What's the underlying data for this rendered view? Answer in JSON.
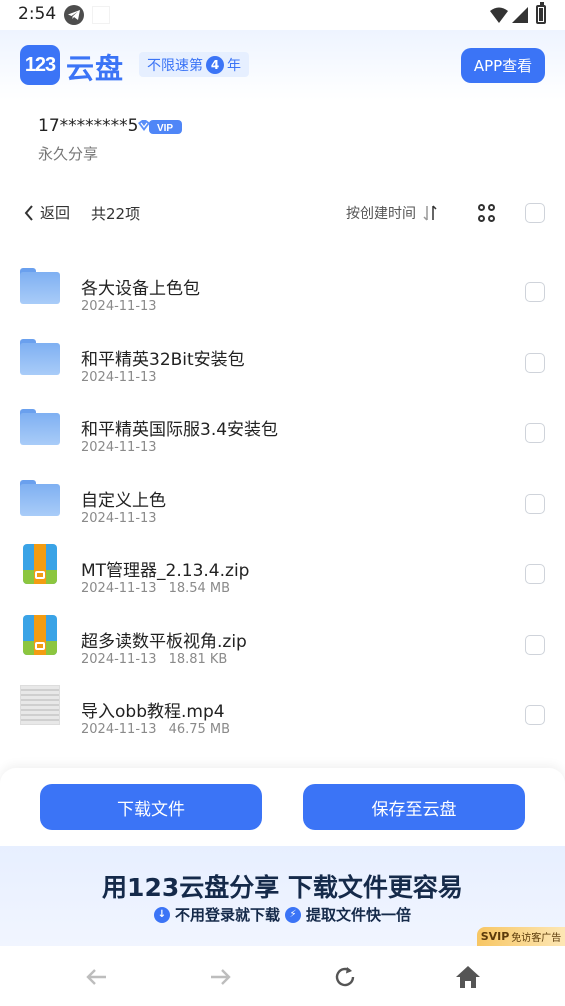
{
  "status_bar": {
    "time": "2:54",
    "icons": [
      "telegram-icon",
      "wifi-icon",
      "signal-icon",
      "battery-icon"
    ]
  },
  "header": {
    "logo_text": "123",
    "brand_name": "云盘",
    "speed_badge_prefix": "不限速第",
    "speed_badge_number": "4",
    "speed_badge_suffix": "年",
    "app_button_label": "APP查看",
    "accent_color": "#3b74f6"
  },
  "share": {
    "user": "17********5",
    "vip_label": "VIP",
    "share_type": "永久分享"
  },
  "toolbar": {
    "back_label": "返回",
    "count_label": "共22项",
    "sort_label": "按创建时间"
  },
  "files": [
    {
      "name": "各大设备上色包",
      "date": "2024-11-13",
      "size": "",
      "type": "folder"
    },
    {
      "name": "和平精英32Bit安装包",
      "date": "2024-11-13",
      "size": "",
      "type": "folder"
    },
    {
      "name": "和平精英国际服3.4安装包",
      "date": "2024-11-13",
      "size": "",
      "type": "folder"
    },
    {
      "name": "自定义上色",
      "date": "2024-11-13",
      "size": "",
      "type": "folder"
    },
    {
      "name": "MT管理器_2.13.4.zip",
      "date": "2024-11-13",
      "size": "18.54 MB",
      "type": "zip"
    },
    {
      "name": "超多读数平板视角.zip",
      "date": "2024-11-13",
      "size": "18.81 KB",
      "type": "zip"
    },
    {
      "name": "导入obb教程.mp4",
      "date": "2024-11-13",
      "size": "46.75 MB",
      "type": "video"
    }
  ],
  "actions": {
    "download_label": "下载文件",
    "save_label": "保存至云盘"
  },
  "promo": {
    "title": "用123云盘分享 下载文件更容易",
    "feature_1": "不用登录就下载",
    "feature_2": "提取文件快一倍",
    "svip_badge": "SVIP",
    "svip_text": "免访客广告"
  }
}
